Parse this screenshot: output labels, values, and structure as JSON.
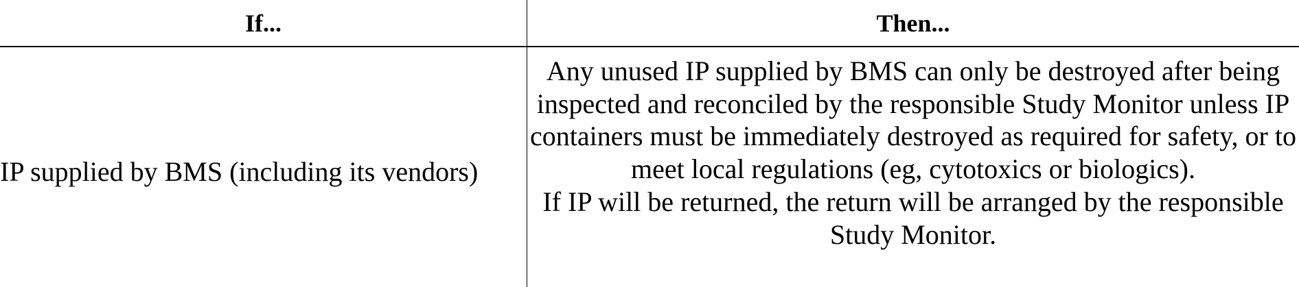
{
  "table": {
    "headers": [
      "If...",
      "Then..."
    ],
    "rows": [
      {
        "if": "IP supplied by BMS (including its vendors)",
        "then": [
          "Any unused IP supplied by BMS can only be destroyed after being inspected and reconciled by the responsible Study Monitor unless IP containers must be immediately destroyed as required for safety, or to meet local regulations (eg, cytotoxics or biologics).",
          "If IP will be returned, the return will be arranged by the responsible Study Monitor."
        ]
      }
    ]
  }
}
